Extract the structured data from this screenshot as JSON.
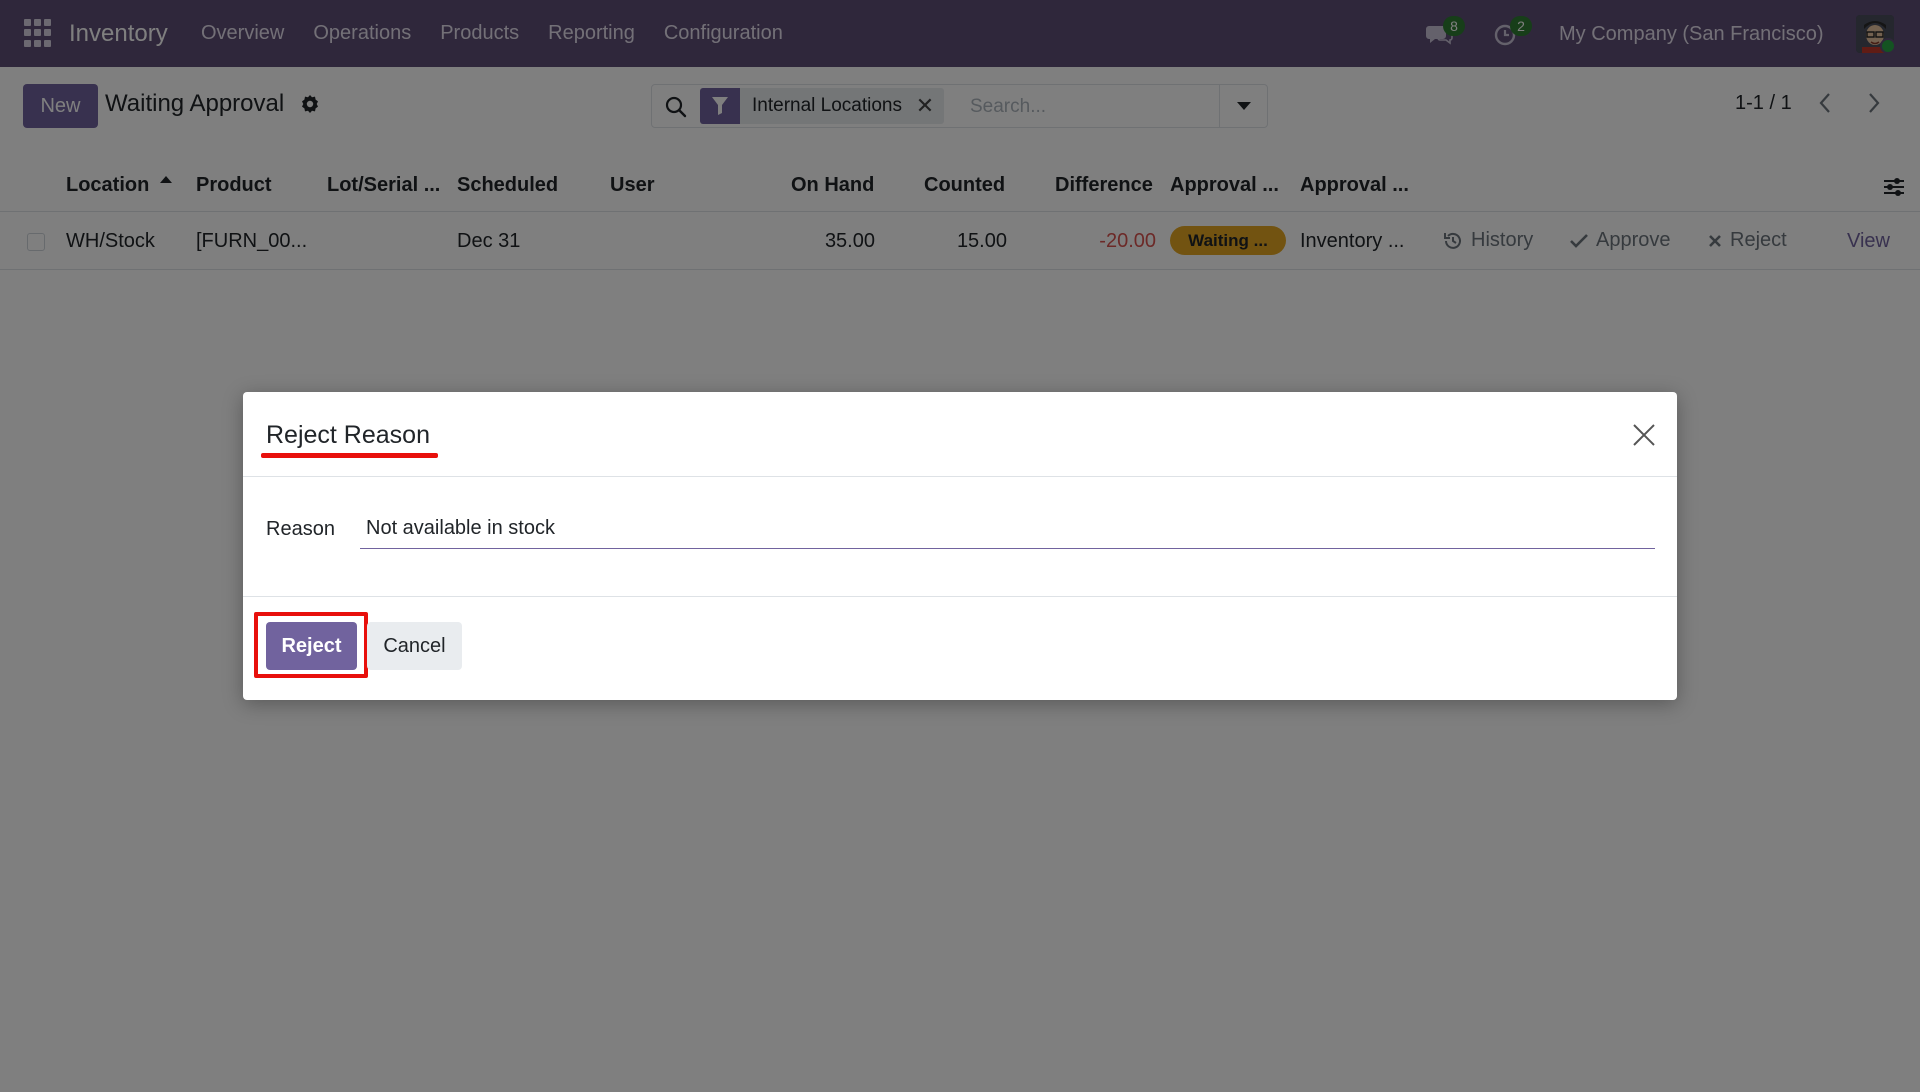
{
  "navbar": {
    "app_name": "Inventory",
    "menu": [
      "Overview",
      "Operations",
      "Products",
      "Reporting",
      "Configuration"
    ],
    "messages_count": "8",
    "activities_count": "2",
    "company": "My Company (San Francisco)"
  },
  "control_panel": {
    "new_label": "New",
    "title": "Waiting Approval",
    "facet_label": "Internal Locations",
    "search_placeholder": "Search...",
    "pager": "1-1 / 1"
  },
  "list": {
    "columns": [
      "Location",
      "Product",
      "Lot/Serial ...",
      "Scheduled",
      "User",
      "On Hand",
      "Counted",
      "Difference",
      "Approval ...",
      "Approval ..."
    ],
    "sorted_column": "Location",
    "rows": [
      {
        "location": "WH/Stock",
        "product": "[FURN_00...",
        "lot": "",
        "scheduled": "Dec 31",
        "user": "",
        "on_hand": "35.00",
        "counted": "15.00",
        "difference": "-20.00",
        "approval_status": "Waiting ...",
        "approval_group": "Inventory ...",
        "history_label": "History",
        "approve_label": "Approve",
        "reject_label": "Reject",
        "view_label": "View"
      }
    ]
  },
  "dialog": {
    "title": "Reject Reason",
    "field_label": "Reason",
    "field_value": "Not available in stock",
    "reject_label": "Reject",
    "cancel_label": "Cancel"
  },
  "colors": {
    "navbar": "#5e4e77",
    "primary": "#71639e",
    "warning_badge": "#e5a722",
    "negative": "#d9534f",
    "annotation_red": "#e8100c"
  }
}
